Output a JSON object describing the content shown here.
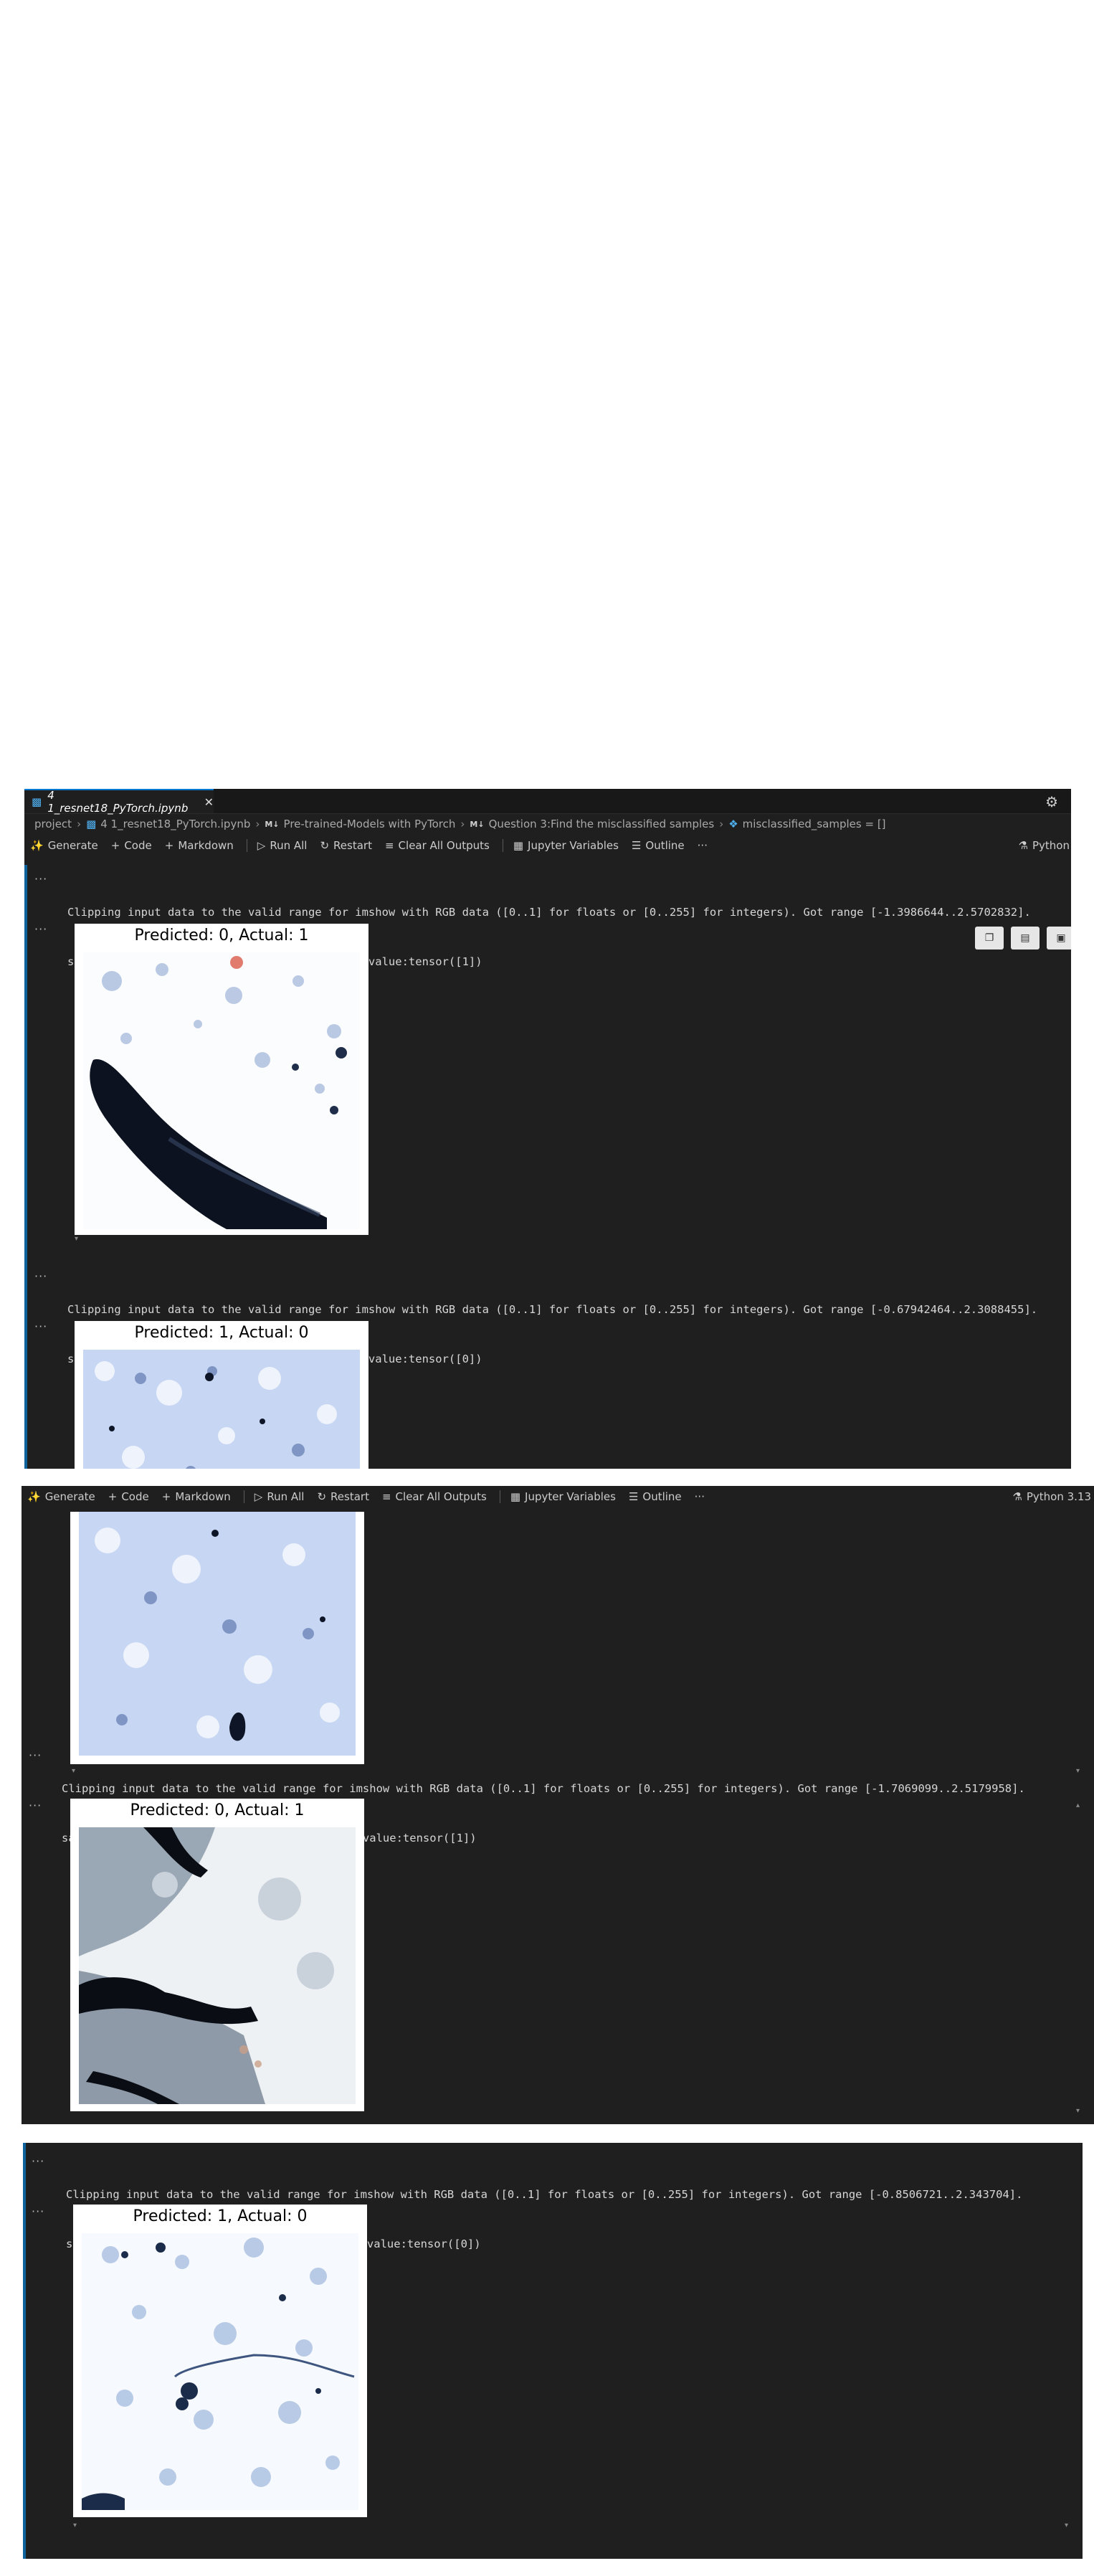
{
  "editor": {
    "tab_title": "4 1_resnet18_PyTorch.ipynb",
    "breadcrumb": {
      "folder": "project",
      "file": "4 1_resnet18_PyTorch.ipynb",
      "md_badge": "M↓",
      "section1": "Pre-trained-Models with PyTorch",
      "section2": "Question 3:Find the misclassified samples",
      "symbol": "misclassified_samples = []"
    },
    "toolbar": {
      "generate": "Generate",
      "code": "Code",
      "markdown": "Markdown",
      "run_all": "Run All",
      "restart": "Restart",
      "clear_all": "Clear All Outputs",
      "variables": "Jupyter Variables",
      "outline": "Outline",
      "more": "···",
      "kernel_top": "Python",
      "kernel_full": "Python 3.13"
    },
    "ellipsis": "···"
  },
  "outputs": [
    {
      "line1": "Clipping input data to the valid range for imshow with RGB data ([0..1] for floats or [0..255] for integers). Got range [-1.3986644..2.5702832].",
      "line2": "sample0 predicted value: tensor([0])  actual value:tensor([1])",
      "fig_title": "Predicted: 0, Actual: 1"
    },
    {
      "line1": "Clipping input data to the valid range for imshow with RGB data ([0..1] for floats or [0..255] for integers). Got range [-0.67942464..2.3088455].",
      "line2": "sample1 predicted value: tensor([1])  actual value:tensor([0])",
      "fig_title": "Predicted: 1, Actual: 0"
    },
    {
      "line1": "Clipping input data to the valid range for imshow with RGB data ([0..1] for floats or [0..255] for integers). Got range [-1.7069099..2.5179958].",
      "line2": "sample2 predicted value: tensor([0])  actual value:tensor([1])",
      "fig_title": "Predicted: 0, Actual: 1"
    },
    {
      "line1": "Clipping input data to the valid range for imshow with RGB data ([0..1] for floats or [0..255] for integers). Got range [-0.8506721..2.343704].",
      "line2": "sample3 predicted value: tensor([1])  actual value:tensor([0])",
      "fig_title": "Predicted: 1, Actual: 0"
    }
  ],
  "colors": {
    "editor_bg": "#1f1f1f",
    "accent": "#0078d4",
    "output_text": "#d6d6d6"
  }
}
